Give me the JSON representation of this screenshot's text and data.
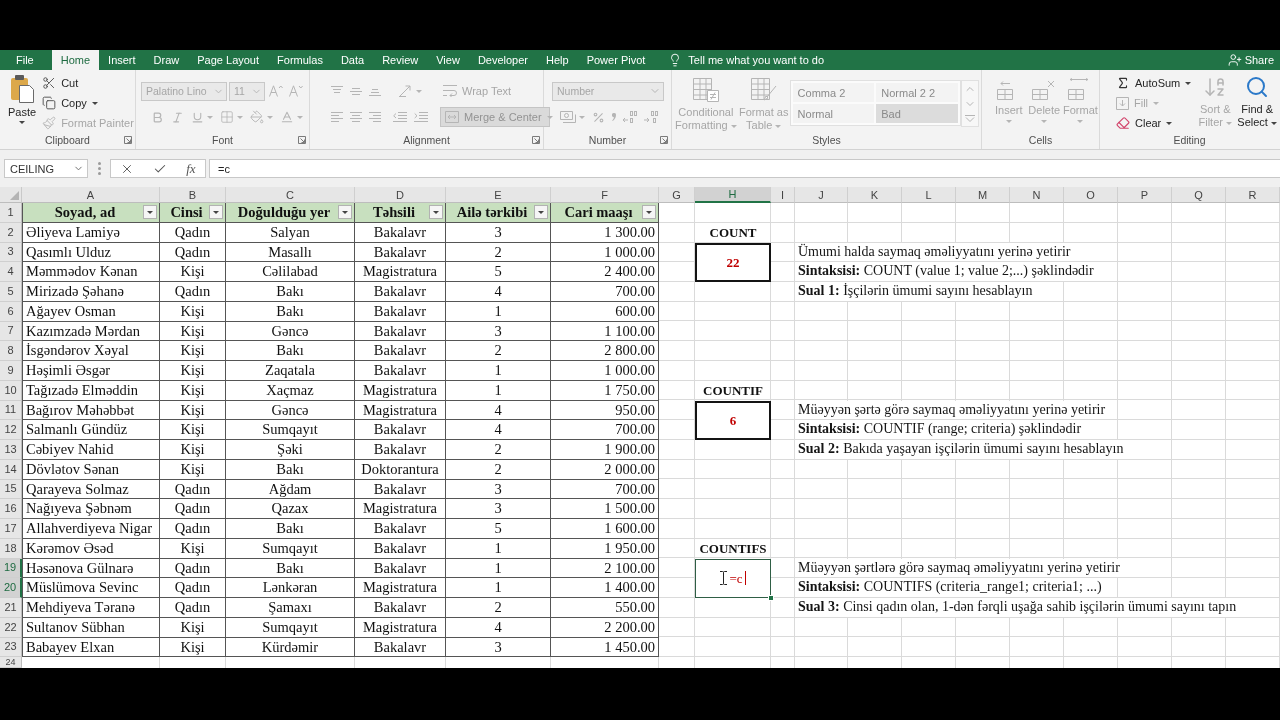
{
  "ribbon_tabs": [
    {
      "label": "File",
      "selected": false
    },
    {
      "label": "Home",
      "selected": true
    },
    {
      "label": "Insert",
      "selected": false
    },
    {
      "label": "Draw",
      "selected": false
    },
    {
      "label": "Page Layout",
      "selected": false
    },
    {
      "label": "Formulas",
      "selected": false
    },
    {
      "label": "Data",
      "selected": false
    },
    {
      "label": "Review",
      "selected": false
    },
    {
      "label": "View",
      "selected": false
    },
    {
      "label": "Developer",
      "selected": false
    },
    {
      "label": "Help",
      "selected": false
    },
    {
      "label": "Power Pivot",
      "selected": false
    }
  ],
  "tell_me": {
    "placeholder": "Tell me what you want to do"
  },
  "share_button": "Share",
  "ribbon": {
    "clipboard": {
      "label": "Clipboard",
      "paste": {
        "label": "Paste",
        "disabled": false
      },
      "items": [
        {
          "label": "Cut",
          "disabled": false
        },
        {
          "label": "Copy",
          "disabled": false
        },
        {
          "label": "Format Painter",
          "disabled": true
        }
      ]
    },
    "font": {
      "label": "Font",
      "font_name": "Palatino Lino",
      "font_size": "11",
      "disabled": true
    },
    "alignment": {
      "label": "Alignment",
      "wrap_text": "Wrap Text",
      "merge_center": {
        "label": "Merge & Center",
        "on": true
      },
      "disabled": true
    },
    "number": {
      "label": "Number",
      "format": "Number",
      "disabled": true
    },
    "styles": {
      "label": "Styles",
      "buttons": [
        {
          "label": "Conditional Formatting",
          "disabled": true
        },
        {
          "label": "Format as Table",
          "disabled": true
        }
      ],
      "gallery": [
        {
          "label": "Comma 2",
          "kind": "plain"
        },
        {
          "label": "Normal 2 2",
          "kind": "plain"
        },
        {
          "label": "Normal",
          "kind": "plain"
        },
        {
          "label": "Bad",
          "kind": "bad"
        }
      ],
      "disabled": true
    },
    "cells": {
      "label": "Cells",
      "buttons": [
        {
          "label": "Insert",
          "disabled": true
        },
        {
          "label": "Delete",
          "disabled": true
        },
        {
          "label": "Format",
          "disabled": true
        }
      ]
    },
    "editing": {
      "label": "Editing",
      "small_buttons": [
        {
          "label": "AutoSum",
          "disabled": false
        },
        {
          "label": "Fill",
          "disabled": true
        },
        {
          "label": "Clear",
          "disabled": false
        }
      ],
      "large_buttons": [
        {
          "label": "Sort & Filter",
          "disabled": true
        },
        {
          "label": "Find & Select",
          "disabled": false
        }
      ]
    }
  },
  "formula_bar": {
    "name_box": "CEILING",
    "function_button": "fx",
    "formula": "=c"
  },
  "sheet": {
    "columns": [
      {
        "label": "A",
        "selected": false
      },
      {
        "label": "B",
        "selected": false
      },
      {
        "label": "C",
        "selected": false
      },
      {
        "label": "D",
        "selected": false
      },
      {
        "label": "E",
        "selected": false
      },
      {
        "label": "F",
        "selected": false
      },
      {
        "label": "G",
        "selected": false
      },
      {
        "label": "H",
        "selected": true
      },
      {
        "label": "I",
        "selected": false
      },
      {
        "label": "J",
        "selected": false
      },
      {
        "label": "K",
        "selected": false
      },
      {
        "label": "L",
        "selected": false
      },
      {
        "label": "M",
        "selected": false
      },
      {
        "label": "N",
        "selected": false
      },
      {
        "label": "O",
        "selected": false
      },
      {
        "label": "P",
        "selected": false
      },
      {
        "label": "Q",
        "selected": false
      },
      {
        "label": "R",
        "selected": false
      }
    ],
    "rows": [
      {
        "label": "1",
        "selected": false
      },
      {
        "label": "2",
        "selected": false
      },
      {
        "label": "3",
        "selected": false
      },
      {
        "label": "4",
        "selected": false
      },
      {
        "label": "5",
        "selected": false
      },
      {
        "label": "6",
        "selected": false
      },
      {
        "label": "7",
        "selected": false
      },
      {
        "label": "8",
        "selected": false
      },
      {
        "label": "9",
        "selected": false
      },
      {
        "label": "10",
        "selected": false
      },
      {
        "label": "11",
        "selected": false
      },
      {
        "label": "12",
        "selected": false
      },
      {
        "label": "13",
        "selected": false
      },
      {
        "label": "14",
        "selected": false
      },
      {
        "label": "15",
        "selected": false
      },
      {
        "label": "16",
        "selected": false
      },
      {
        "label": "17",
        "selected": false
      },
      {
        "label": "18",
        "selected": false
      },
      {
        "label": "19",
        "selected": true
      },
      {
        "label": "20",
        "selected": true
      },
      {
        "label": "21",
        "selected": false
      },
      {
        "label": "22",
        "selected": false
      },
      {
        "label": "23",
        "selected": false
      },
      {
        "label": "24",
        "selected": false
      }
    ]
  },
  "table": {
    "headers": [
      "Soyad, ad",
      "Cinsi",
      "Doğulduğu yer",
      "Təhsili",
      "Ailə tərkibi",
      "Cari maaşı"
    ],
    "rows": [
      [
        "Əliyeva Lamiyə",
        "Qadın",
        "Salyan",
        "Bakalavr",
        "3",
        "1 300.00"
      ],
      [
        "Qasımlı Ulduz",
        "Qadın",
        "Masallı",
        "Bakalavr",
        "2",
        "1 000.00"
      ],
      [
        "Məmmədov Kənan",
        "Kişi",
        "Cəlilabad",
        "Magistratura",
        "5",
        "2 400.00"
      ],
      [
        "Mirizadə Şəhanə",
        "Qadın",
        "Bakı",
        "Bakalavr",
        "4",
        "700.00"
      ],
      [
        "Ağayev Osman",
        "Kişi",
        "Bakı",
        "Bakalavr",
        "1",
        "600.00"
      ],
      [
        "Kazımzadə Mərdan",
        "Kişi",
        "Gəncə",
        "Bakalavr",
        "3",
        "1 100.00"
      ],
      [
        "İsgəndərov Xəyal",
        "Kişi",
        "Bakı",
        "Bakalavr",
        "2",
        "2 800.00"
      ],
      [
        "Həşimli Əsgər",
        "Kişi",
        "Zaqatala",
        "Bakalavr",
        "1",
        "1 000.00"
      ],
      [
        "Tağızadə Elməddin",
        "Kişi",
        "Xaçmaz",
        "Magistratura",
        "1",
        "1 750.00"
      ],
      [
        "Bağırov Məhəbbət",
        "Kişi",
        "Gəncə",
        "Magistratura",
        "4",
        "950.00"
      ],
      [
        "Salmanlı Gündüz",
        "Kişi",
        "Sumqayıt",
        "Bakalavr",
        "4",
        "700.00"
      ],
      [
        "Cəbiyev Nahid",
        "Kişi",
        "Şəki",
        "Bakalavr",
        "2",
        "1 900.00"
      ],
      [
        "Dövlətov Sənan",
        "Kişi",
        "Bakı",
        "Doktorantura",
        "2",
        "2 000.00"
      ],
      [
        "Qarayeva Solmaz",
        "Qadın",
        "Ağdam",
        "Bakalavr",
        "3",
        "700.00"
      ],
      [
        "Nağıyeva Şəbnəm",
        "Qadın",
        "Qazax",
        "Magistratura",
        "3",
        "1 500.00"
      ],
      [
        "Allahverdiyeva Nigar",
        "Qadın",
        "Bakı",
        "Bakalavr",
        "5",
        "1 600.00"
      ],
      [
        "Kərəmov Əsəd",
        "Kişi",
        "Sumqayıt",
        "Bakalavr",
        "1",
        "1 950.00"
      ],
      [
        "Həsənova Gülnarə",
        "Qadın",
        "Bakı",
        "Bakalavr",
        "1",
        "2 100.00"
      ],
      [
        "Müslümova Sevinc",
        "Qadın",
        "Lənkəran",
        "Magistratura",
        "1",
        "1 400.00"
      ],
      [
        "Mehdiyeva Təranə",
        "Qadın",
        "Şamaxı",
        "Bakalavr",
        "2",
        "550.00"
      ],
      [
        "Sultanov Sübhan",
        "Kişi",
        "Sumqayıt",
        "Magistratura",
        "4",
        "2 200.00"
      ],
      [
        "Babayev Elxan",
        "Kişi",
        "Kürdəmir",
        "Bakalavr",
        "3",
        "1 450.00"
      ]
    ]
  },
  "functions": [
    {
      "name": "COUNT",
      "result": "22",
      "editing": false,
      "lines": [
        "Ümumi halda saymaq əməliyyatını yerinə yetirir",
        "**Sintaksisi:** COUNT (value 1; value 2;...) şəklindədir",
        "**Sual 1:** İşçilərin ümumi sayını hesablayın"
      ]
    },
    {
      "name": "COUNTIF",
      "result": "6",
      "editing": false,
      "lines": [
        "Müəyyən şərtə görə saymaq əməliyyatını yerinə yetirir",
        "**Sintaksisi:** COUNTIF (range; criteria) şəklindədir",
        "**Sual 2:** Bakıda yaşayan işçilərin ümumi sayını hesablayın"
      ]
    },
    {
      "name": "COUNTIFS",
      "result": "=c",
      "editing": true,
      "lines": [
        "Müəyyən şərtlərə görə saymaq əməliyyatını yerinə yetirir",
        "**Sintaksisi:** COUNTIFS (criteria_range1; criteria1; ...)",
        "**Sual 3:** Cinsi qadın olan, 1-dən fərqli uşağa sahib işçilərin ümumi sayını tapın"
      ]
    }
  ]
}
